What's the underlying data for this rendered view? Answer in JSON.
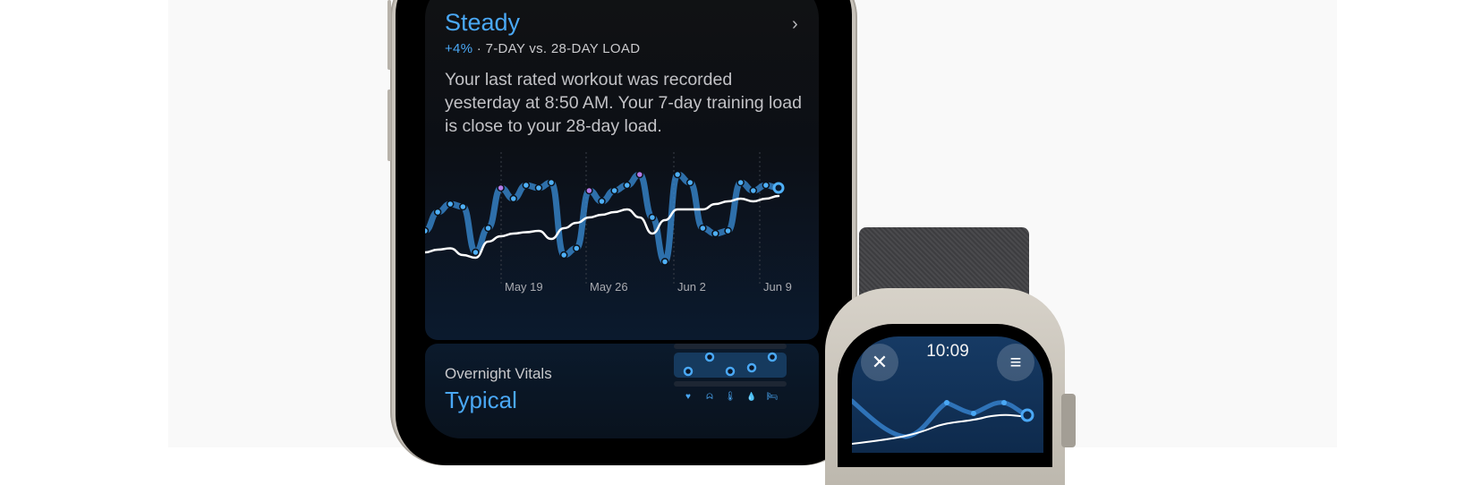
{
  "phone": {
    "training_load": {
      "status": "Steady",
      "change": "+4%",
      "comparison": " · 7-DAY vs. 28-DAY LOAD",
      "description": "Your last rated workout was recorded yesterday at 8:50 AM. Your 7-day training load is close to your 28-day load.",
      "chevron": "›"
    },
    "overnight_vitals": {
      "title": "Overnight Vitals",
      "value": "Typical",
      "icons": [
        "heart-icon",
        "lungs-icon",
        "thermometer-icon",
        "blood-oxygen-icon",
        "bed-icon"
      ]
    }
  },
  "chart_data": {
    "type": "line",
    "xlabel": "",
    "ylabel": "",
    "tick_labels": [
      "May 19",
      "May 26",
      "Jun 2",
      "Jun 9"
    ],
    "series": [
      {
        "name": "7-day load",
        "color": "#3a8fd9",
        "values": [
          28,
          42,
          48,
          46,
          12,
          30,
          60,
          52,
          62,
          60,
          64,
          10,
          15,
          58,
          50,
          58,
          62,
          70,
          38,
          5,
          70,
          64,
          30,
          26,
          28,
          64,
          58,
          62,
          60
        ]
      },
      {
        "name": "28-day load",
        "color": "#ffffff",
        "values": [
          12,
          14,
          15,
          10,
          8,
          20,
          24,
          26,
          27,
          28,
          22,
          30,
          34,
          38,
          40,
          42,
          44,
          38,
          26,
          36,
          44,
          44,
          44,
          48,
          50,
          52,
          50,
          52,
          54
        ]
      }
    ],
    "highlight_points": [
      6,
      13,
      17
    ],
    "ylim": [
      0,
      80
    ]
  },
  "watch": {
    "time": "10:09",
    "close_label": "✕",
    "menu_label": "≡"
  }
}
